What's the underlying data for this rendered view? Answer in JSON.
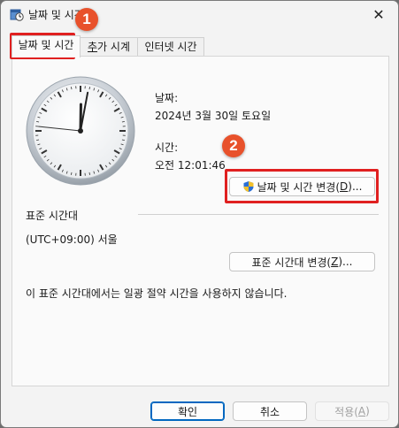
{
  "window": {
    "title": "날짜 및 시간",
    "close_symbol": "✕"
  },
  "tabs": [
    {
      "label": "날짜 및 시간"
    },
    {
      "prefix": "추",
      "label_rest": "가 시계"
    },
    {
      "label": "인터넷 시간"
    }
  ],
  "date": {
    "label": "날짜:",
    "value": "2024년 3월 30일 토요일"
  },
  "time": {
    "label": "시간:",
    "value": "오전 12:01:46"
  },
  "change_datetime_button": {
    "text": "날짜 및 시간 변경(",
    "mnemonic": "D",
    "suffix": ")..."
  },
  "timezone": {
    "section_label": "표준 시간대",
    "value": "(UTC+09:00) 서울",
    "change_button": {
      "text": "표준 시간대 변경(",
      "mnemonic": "Z",
      "suffix": ")..."
    },
    "dst_note": "이 표준 시간대에서는 일광 절약 시간을 사용하지 않습니다."
  },
  "clock": {
    "hour": 0,
    "minute": 1,
    "second": 46
  },
  "footer": {
    "ok": "확인",
    "cancel": "취소",
    "apply": {
      "text": "적용(",
      "mnemonic": "A",
      "suffix": ")"
    }
  },
  "annotations": {
    "badge1": "1",
    "badge2": "2",
    "color": "#e02020"
  }
}
